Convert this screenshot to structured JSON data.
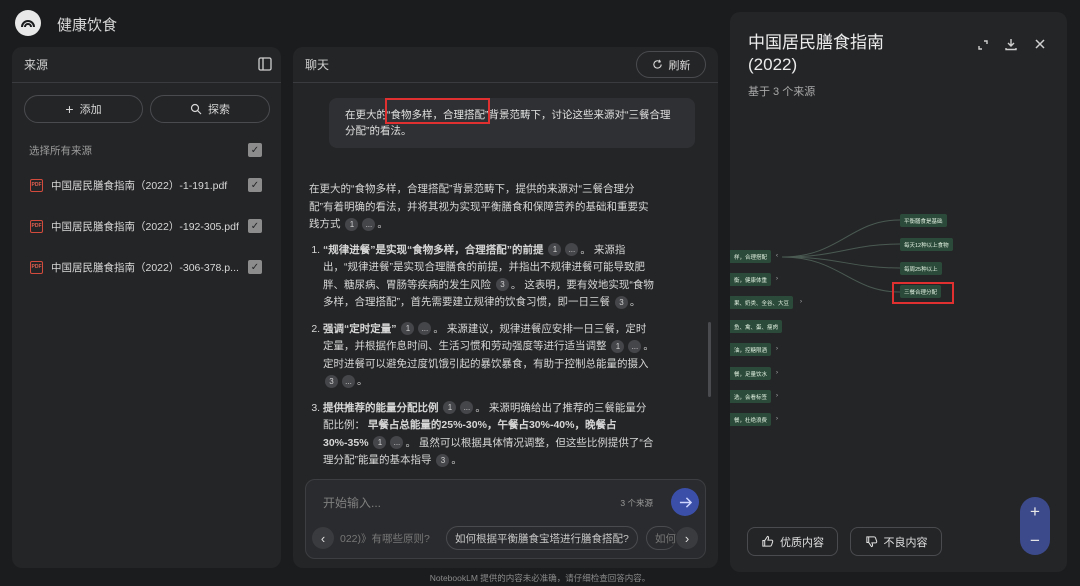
{
  "app": {
    "title": "健康饮食"
  },
  "sources": {
    "header": "来源",
    "add_label": "添加",
    "explore_label": "探索",
    "select_all": "选择所有来源",
    "items": [
      {
        "icon": "PDF",
        "name": "中国居民膳食指南（2022）-1-191.pdf"
      },
      {
        "icon": "PDF",
        "name": "中国居民膳食指南（2022）-192-305.pdf"
      },
      {
        "icon": "PDF",
        "name": "中国居民膳食指南（2022）-306-378.p..."
      }
    ]
  },
  "chat": {
    "header": "聊天",
    "refresh_label": "刷新",
    "user_message": "在更大的“食物多样，合理搭配”背景范畴下，讨论这些来源对“三餐合理分配”的看法。",
    "response_intro": "在更大的“食物多样，合理搭配”背景范畴下，提供的来源对“三餐合理分配”有着明确的看法，并将其视为实现平衡膳食和保障营养的基础和重要实践方式",
    "points": [
      {
        "bold": "“规律进餐”是实现“食物多样，合理搭配”的前提",
        "text": "来源指出，“规律进餐”是实现合理膳食的前提，并指出不规律进餐可能导致肥胖、糖尿病、胃肠等疾病的发生风险",
        "text2": "这表明，要有效地实现“食物多样，合理搭配”，首先需要建立规律的饮食习惯，即一日三餐"
      },
      {
        "bold": "强调“定时定量”",
        "text": "来源建议，规律进餐应安排一日三餐，定时定量，并根据作息时间、生活习惯和劳动强度等进行适当调整",
        "text2": "定时进餐可以避免过度饥饿引起的暴饮暴食，有助于控制总能量的摄入"
      },
      {
        "bold": "提供推荐的能量分配比例",
        "text": "来源明确给出了推荐的三餐能量分配比例：",
        "bold2": "早餐占总能量的25%-30%，午餐占30%-40%，晚餐占30%-35%",
        "text2": "虽然可以根据具体情况调整，但这些比例提供了“合理分配”能量的基本指导"
      }
    ],
    "input_placeholder": "开始输入...",
    "source_count": "3 个来源",
    "suggestions": [
      "022)》有哪些原则?",
      "如何根据平衡膳食宝塔进行膳食搭配?",
      "如何"
    ]
  },
  "studio": {
    "title": "中国居民膳食指南 (2022)",
    "subtitle": "基于 3 个来源",
    "mindmap": {
      "right_nodes": [
        "平衡膳食是基础",
        "每天12种以上食物",
        "每周25种以上",
        "三餐合理分配"
      ],
      "left_nodes": [
        "样，合理搭配",
        "衡，健康体重",
        "果、奶类、全谷、大豆",
        "鱼、禽、蛋、瘦肉",
        "油，控糖限酒",
        "餐，足量饮水",
        "选，会看标签",
        "餐，杜绝浪费"
      ]
    },
    "good_label": "优质内容",
    "bad_label": "不良内容"
  },
  "footer": "NotebookLM 提供的内容未必准确，请仔细检查回答内容。",
  "colors": {
    "accent": "#3b4fa8",
    "highlight": "#e03030",
    "node": "#2c4a3a"
  }
}
